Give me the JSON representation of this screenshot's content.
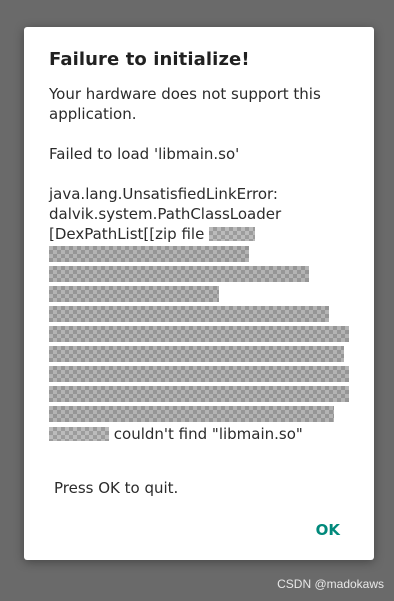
{
  "dialog": {
    "title": "Failure to initialize!",
    "hardware_message_line1": "Your hardware does not support this",
    "hardware_message_line2": "application.",
    "load_error": "Failed to load 'libmain.so'",
    "exception_line1": "java.lang.UnsatisfiedLinkError:",
    "exception_line2": "dalvik.system.PathClassLoader",
    "exception_line3": "[DexPathList[[zip file",
    "exception_last_line": "couldn't find \"libmain.so\"",
    "quit_message": "Press OK to quit.",
    "ok_label": "OK"
  },
  "watermark": "CSDN @madokaws",
  "colors": {
    "accent": "#00897b",
    "background_dim": "#6a6a6a"
  }
}
